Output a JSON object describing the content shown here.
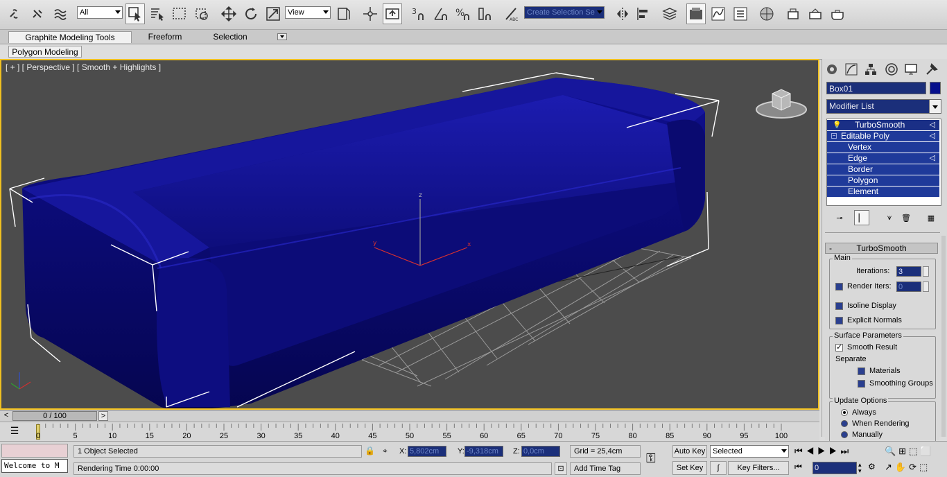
{
  "toolbar": {
    "selection_filter": "All",
    "ref_coord": "View",
    "named_selection_placeholder": "Create Selection Se",
    "icons": [
      "link-icon",
      "unlink-icon",
      "bind-spacewarp-icon",
      "select-object-icon",
      "select-by-name-icon",
      "rect-region-icon",
      "window-crossing-icon",
      "move-icon",
      "rotate-icon",
      "scale-icon",
      "pivot-icon",
      "manipulate-icon",
      "keyboard-shortcut-icon",
      "snaps-toggle-icon",
      "angle-snap-icon",
      "percent-snap-icon",
      "spinner-snap-icon",
      "edit-named-sel-icon",
      "mirror-icon",
      "align-icon",
      "layer-manager-icon",
      "graphite-tools-icon",
      "curve-editor-icon",
      "schematic-view-icon",
      "material-editor-icon",
      "render-setup-icon",
      "rendered-frame-icon",
      "render-production-icon"
    ]
  },
  "ribbon": {
    "tabs": [
      "Graphite Modeling Tools",
      "Freeform",
      "Selection"
    ],
    "active_tab": "Graphite Modeling Tools",
    "sub_tab": "Polygon Modeling"
  },
  "viewport": {
    "label": "[ + ] [ Perspective ] [ Smooth + Highlights ]",
    "gizmo_labels": {
      "z": "z",
      "x": "x",
      "y": "y"
    },
    "object_color": "#0a0a8a"
  },
  "command_panel": {
    "tab_icons": [
      "create-icon",
      "modify-icon",
      "hierarchy-icon",
      "motion-icon",
      "display-icon",
      "utilities-icon"
    ],
    "object_name": "Box01",
    "object_color": "#050f8c",
    "modifier_list": "Modifier List",
    "stack": [
      {
        "label": "TurboSmooth",
        "level": 0
      },
      {
        "label": "Editable Poly",
        "level": 0
      },
      {
        "label": "Vertex",
        "level": 1
      },
      {
        "label": "Edge",
        "level": 1
      },
      {
        "label": "Border",
        "level": 1
      },
      {
        "label": "Polygon",
        "level": 1
      },
      {
        "label": "Element",
        "level": 1
      }
    ],
    "rollout": {
      "title": "TurboSmooth",
      "collapse_sign": "-",
      "main_group": "Main",
      "iterations_label": "Iterations:",
      "iterations_value": "3",
      "render_iters_label": "Render Iters:",
      "render_iters_value": "0",
      "render_iters_checked": false,
      "isoline_label": "Isoline Display",
      "isoline_checked": false,
      "explicit_label": "Explicit Normals",
      "explicit_checked": false,
      "surface_group": "Surface Parameters",
      "smooth_result_label": "Smooth Result",
      "smooth_result_checked": true,
      "separate_label": "Separate",
      "materials_label": "Materials",
      "materials_checked": false,
      "smoothing_groups_label": "Smoothing Groups",
      "smoothing_groups_checked": false,
      "update_group": "Update Options",
      "update_options": [
        "Always",
        "When Rendering",
        "Manually"
      ],
      "update_selected": "Always"
    }
  },
  "timeline": {
    "frame_display": "0 / 100",
    "prev": "<",
    "next": ">",
    "ticks": [
      "0",
      "5",
      "10",
      "15",
      "20",
      "25",
      "30",
      "35",
      "40",
      "45",
      "50",
      "55",
      "60",
      "65",
      "70",
      "75",
      "80",
      "85",
      "90",
      "95",
      "100"
    ]
  },
  "status": {
    "maxscript_text": "Welcome to M",
    "selection_status": "1 Object Selected",
    "prompt": "Rendering Time  0:00:00",
    "x_label": "X:",
    "x_value": "5,802cm",
    "y_label": "Y:",
    "y_value": "-9,318cm",
    "z_label": "Z:",
    "z_value": "0,0cm",
    "grid": "Grid = 25,4cm",
    "add_time_tag": "Add Time Tag",
    "auto_key": "Auto Key",
    "set_key": "Set Key",
    "key_mode": "Selected",
    "key_filters": "Key Filters...",
    "current_frame": "0"
  }
}
